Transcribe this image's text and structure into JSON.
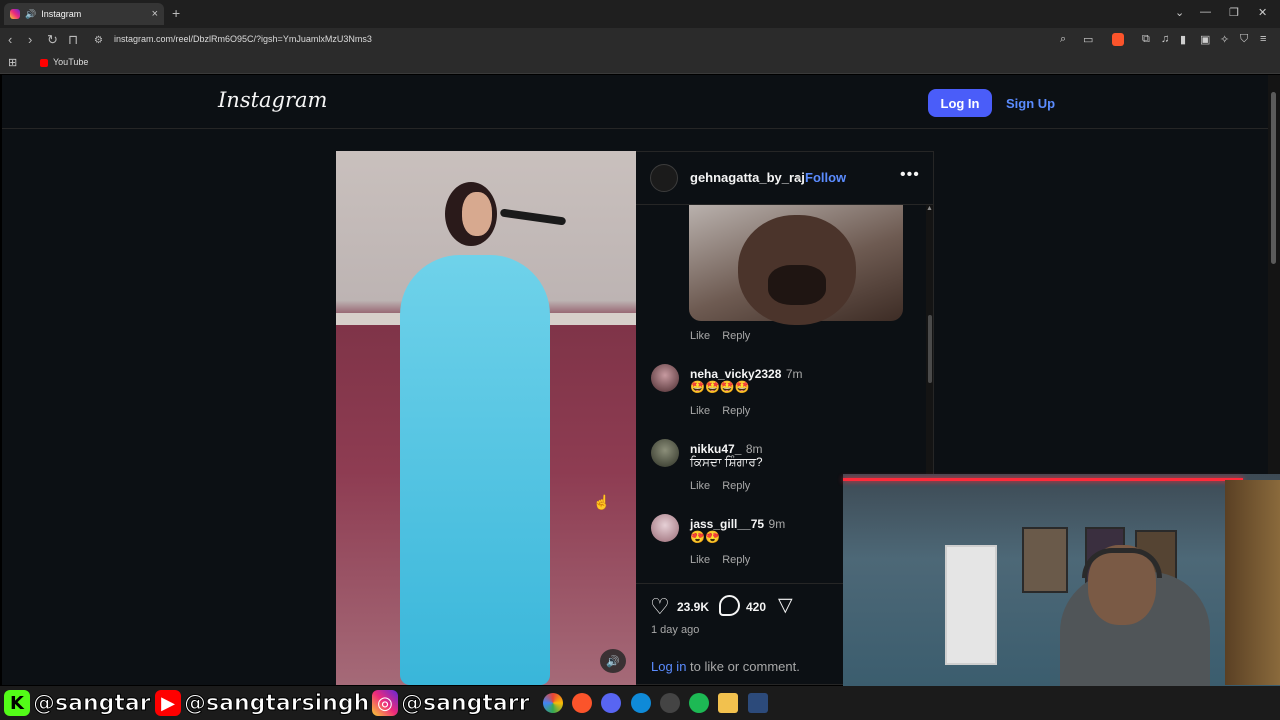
{
  "browser": {
    "tab_title": "Instagram",
    "new_tab": "+",
    "close_tab": "×",
    "url": "instagram.com/reel/DbzlRm6O95C/?igsh=YmJuamlxMzU3Nms3",
    "bookmark_youtube": "YouTube"
  },
  "header": {
    "logo": "Instagram",
    "login_label": "Log In",
    "signup_label": "Sign Up"
  },
  "post": {
    "username": "gehnagatta_by_raj",
    "dot": "•",
    "follow_label": "Follow",
    "more": "•••",
    "likes": "23.9K",
    "comments_count": "420",
    "date": "1 day ago",
    "login_link": "Log in",
    "login_suffix": " to like or comment."
  },
  "comments": [
    {
      "user": "",
      "time": "",
      "text": "",
      "like": "Like",
      "reply": "Reply"
    },
    {
      "user": "neha_vicky2328",
      "time": "7m",
      "text": "🤩🤩🤩🤩",
      "like": "Like",
      "reply": "Reply"
    },
    {
      "user": "nikku47_",
      "time": "8m",
      "text": "ਕਿਸਦਾ ਸ਼ਿੰਗਾਰ?",
      "like": "Like",
      "reply": "Reply"
    },
    {
      "user": "jass_gill__75",
      "time": "9m",
      "text": "😍😍",
      "like": "Like",
      "reply": "Reply"
    }
  ],
  "overlay": {
    "kick": "@sangtar",
    "youtube": "@sangtarsingh",
    "instagram": "@sangtarr"
  },
  "colors": {
    "accent": "#4a5df9",
    "link": "#5b8cff",
    "page_bg": "#0c1014"
  }
}
